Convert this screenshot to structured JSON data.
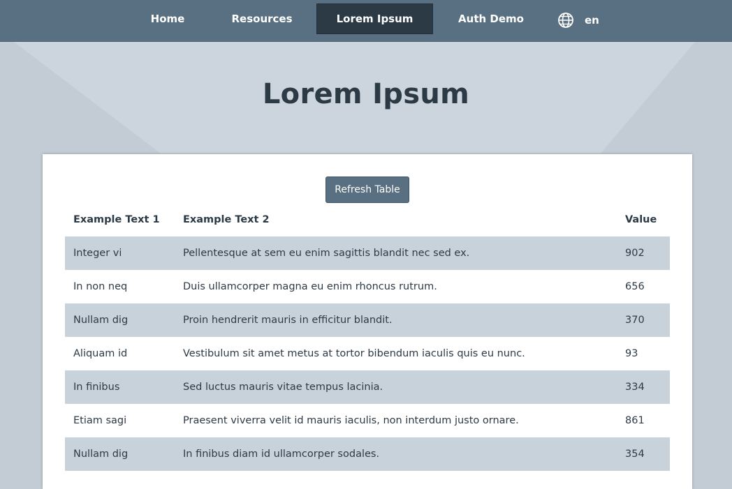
{
  "nav": {
    "items": [
      {
        "label": "Home"
      },
      {
        "label": "Resources"
      },
      {
        "label": "Lorem Ipsum"
      },
      {
        "label": "Auth Demo"
      }
    ],
    "active": "Lorem Ipsum",
    "language": {
      "icon": "globe-icon",
      "label": "en"
    }
  },
  "page": {
    "title": "Lorem Ipsum"
  },
  "table_card": {
    "refresh_label": "Refresh Table",
    "headers": [
      "Example Text 1",
      "Example Text 2",
      "Value"
    ],
    "rows": [
      {
        "text1": "Integer vi",
        "text2": "Pellentesque at sem eu enim sagittis blandit nec sed ex.",
        "value": "902"
      },
      {
        "text1": "In non neq",
        "text2": "Duis ullamcorper magna eu enim rhoncus rutrum.",
        "value": "656"
      },
      {
        "text1": "Nullam dig",
        "text2": "Proin hendrerit mauris in efficitur blandit.",
        "value": "370"
      },
      {
        "text1": "Aliquam id",
        "text2": "Vestibulum sit amet metus at tortor bibendum iaculis quis eu nunc.",
        "value": "93"
      },
      {
        "text1": "In finibus",
        "text2": "Sed luctus mauris vitae tempus lacinia.",
        "value": "334"
      },
      {
        "text1": "Etiam sagi",
        "text2": "Praesent viverra velit id mauris iaculis, non interdum justo ornare.",
        "value": "861"
      },
      {
        "text1": "Nullam dig",
        "text2": "In finibus diam id ullamcorper sodales.",
        "value": "354"
      }
    ]
  },
  "colors": {
    "navbar": "#587081",
    "nav_active": "#2c3a46",
    "background": "#c3ccd5",
    "row_stripe": "#c8d2db",
    "text": "#2c3a46"
  }
}
